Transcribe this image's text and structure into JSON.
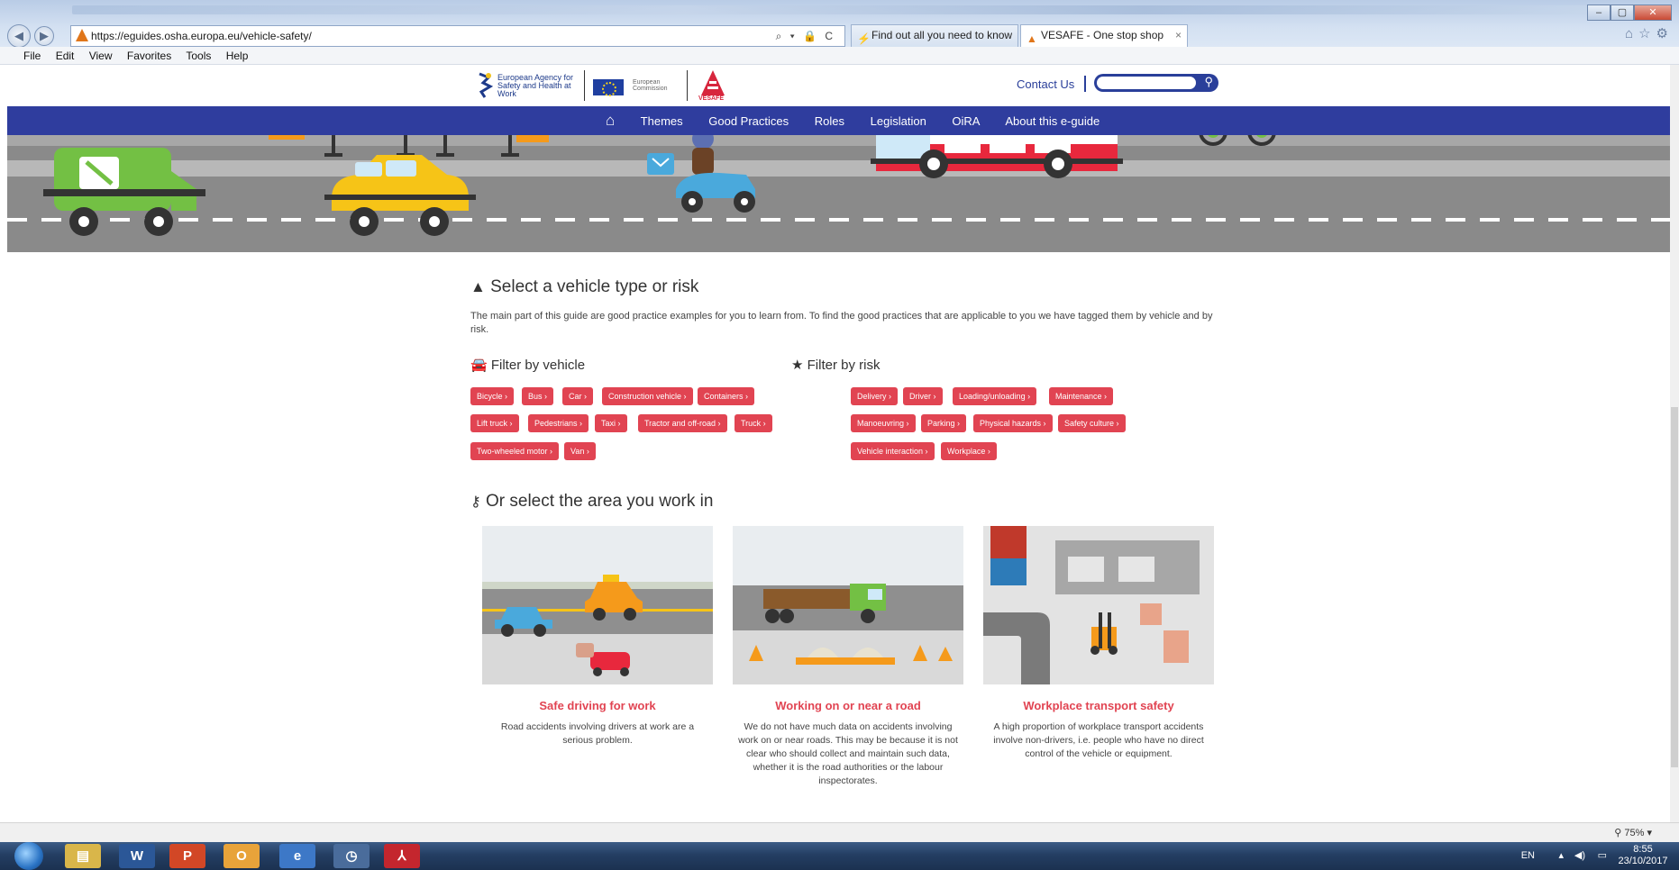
{
  "browser": {
    "url": "https://eguides.osha.europa.eu/vehicle-safety/",
    "tabs": [
      {
        "label": "Find out all you need to know ..."
      },
      {
        "label": "VESAFE - One stop shop for...",
        "close": "×"
      }
    ],
    "menu": [
      "File",
      "Edit",
      "View",
      "Favorites",
      "Tools",
      "Help"
    ],
    "address_controls": "⌕ ▾ 🔒 C",
    "zoom": "75%"
  },
  "site": {
    "osha_name": "European Agency for Safety and Health at Work",
    "ec_name": "European Commission",
    "vesafe_name": "VESAFE",
    "contact": "Contact Us",
    "nav": [
      "Themes",
      "Good Practices",
      "Roles",
      "Legislation",
      "OiRA",
      "About this e-guide"
    ]
  },
  "select": {
    "title": "Select a vehicle type or risk",
    "intro": "The main part of this guide are good practice examples for you to learn from. To find the good practices that are applicable to you we have tagged them by vehicle and by risk.",
    "vehicle_title": "Filter by vehicle",
    "risk_title": "Filter by risk",
    "vehicle_tags": [
      "Bicycle",
      "Bus",
      "Car",
      "Construction vehicle",
      "Containers",
      "Lift truck",
      "Pedestrians",
      "Taxi",
      "Tractor and off-road",
      "Truck",
      "Two-wheeled motor",
      "Van"
    ],
    "risk_tags": [
      "Delivery",
      "Driver",
      "Loading/unloading",
      "Maintenance",
      "Manoeuvring",
      "Parking",
      "Physical hazards",
      "Safety culture",
      "Vehicle interaction",
      "Workplace"
    ]
  },
  "areas": {
    "title": "Or select the area you work in",
    "cards": [
      {
        "title": "Safe driving for work",
        "desc": "Road accidents involving drivers at work are a serious problem."
      },
      {
        "title": "Working on or near a road",
        "desc": "We do not have much data on accidents involving work on or near roads. This may be because it is not clear who should collect and maintain such data, whether it is the road authorities or the labour inspectorates."
      },
      {
        "title": "Workplace transport safety",
        "desc": "A high proportion of workplace transport accidents involve non-drivers, i.e. people who have no direct control of the vehicle or equipment."
      }
    ]
  },
  "taskbar": {
    "lang": "EN",
    "time": "8:55",
    "date": "23/10/2017"
  },
  "colors": {
    "accent": "#e14452",
    "nav": "#2f3d9e"
  }
}
